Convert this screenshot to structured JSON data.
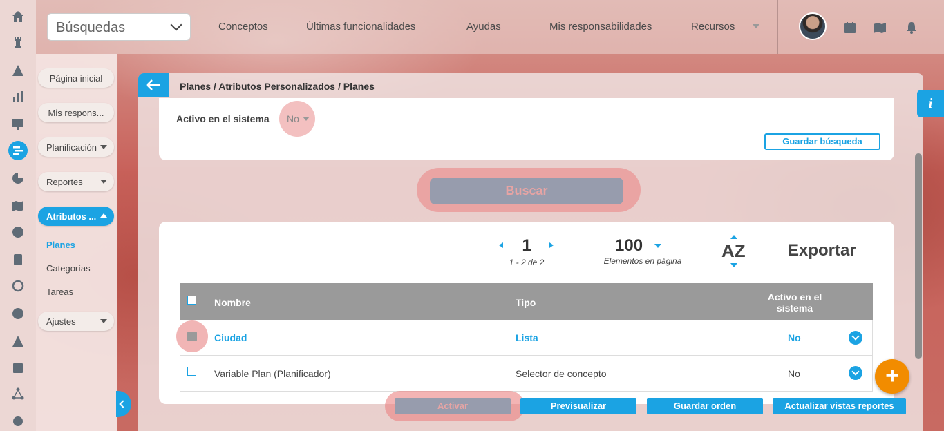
{
  "topbar": {
    "search_select": "Búsquedas",
    "nav": [
      "Conceptos",
      "Últimas funcionalidades",
      "Ayudas",
      "Mis responsabilidades",
      "Recursos"
    ]
  },
  "subnav": {
    "items": [
      {
        "label": "Página inicial"
      },
      {
        "label": "Mis respons..."
      },
      {
        "label": "Planificación"
      },
      {
        "label": "Reportes"
      },
      {
        "label": "Atributos ..."
      },
      {
        "label": "Ajustes"
      }
    ],
    "sublinks": [
      "Planes",
      "Categorías",
      "Tareas"
    ]
  },
  "breadcrumb": "Planes / Atributos Personalizados / Planes",
  "filter": {
    "label": "Activo en el sistema",
    "value": "No",
    "save_search": "Guardar búsqueda",
    "search_button": "Buscar"
  },
  "pagination": {
    "page": "1",
    "range": "1 - 2 de 2",
    "per_page": "100",
    "per_page_label": "Elementos en página",
    "sort": "AZ",
    "export": "Exportar"
  },
  "table": {
    "headers": {
      "name": "Nombre",
      "type": "Tipo",
      "active": "Activo en el sistema"
    },
    "rows": [
      {
        "name": "Ciudad",
        "type": "Lista",
        "active": "No"
      },
      {
        "name": "Variable Plan (Planificador)",
        "type": "Selector de concepto",
        "active": "No"
      }
    ]
  },
  "actions": {
    "activate": "Activar",
    "preview": "Previsualizar",
    "save_order": "Guardar orden",
    "update_reports": "Actualizar vistas reportes"
  },
  "fab": "+",
  "info": "i",
  "colors": {
    "accent": "#1ba3e3",
    "fab": "#f28c00",
    "disabled": "#979cad"
  }
}
